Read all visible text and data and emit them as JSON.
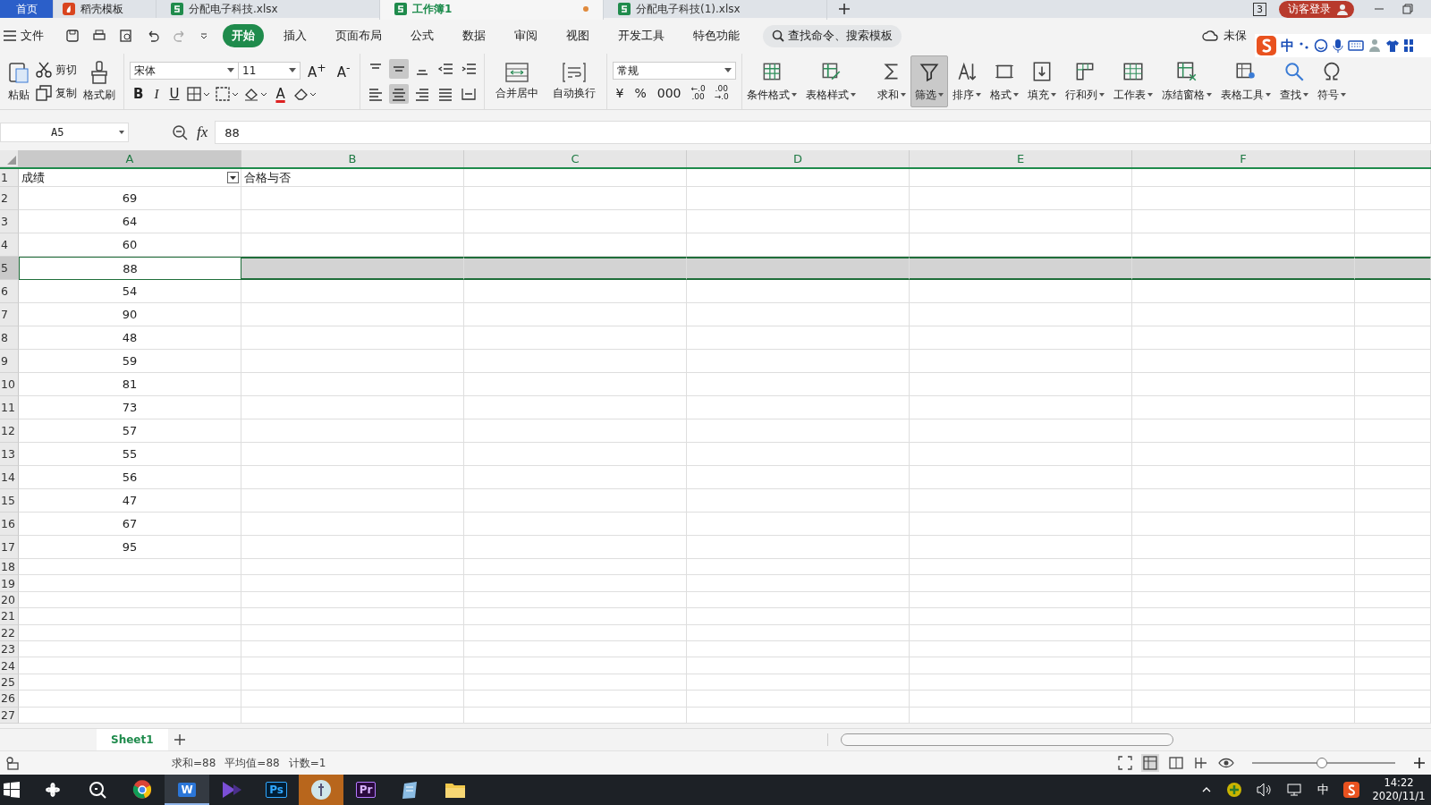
{
  "tabs": [
    {
      "label": "首页",
      "kind": "home",
      "selected": false,
      "unsaved": false
    },
    {
      "label": "稻壳模板",
      "kind": "template",
      "selected": false,
      "unsaved": false
    },
    {
      "label": "分配电子科技.xlsx",
      "kind": "sheet",
      "selected": false,
      "unsaved": false
    },
    {
      "label": "工作簿1",
      "kind": "sheet",
      "selected": true,
      "unsaved": true
    },
    {
      "label": "分配电子科技(1).xlsx",
      "kind": "sheet",
      "selected": false,
      "unsaved": false
    }
  ],
  "window_badge": "3",
  "login_button": "访客登录",
  "menu": {
    "file": "文件",
    "items": [
      {
        "label": "开始",
        "selected": true
      },
      {
        "label": "插入",
        "selected": false
      },
      {
        "label": "页面布局",
        "selected": false
      },
      {
        "label": "公式",
        "selected": false
      },
      {
        "label": "数据",
        "selected": false
      },
      {
        "label": "审阅",
        "selected": false
      },
      {
        "label": "视图",
        "selected": false
      },
      {
        "label": "开发工具",
        "selected": false
      },
      {
        "label": "特色功能",
        "selected": false
      }
    ],
    "search": "查找命令、搜索模板",
    "save_status": "未保"
  },
  "ime": {
    "mode": "中"
  },
  "ribbon": {
    "paste": "粘贴",
    "cut": "剪切",
    "copy": "复制",
    "format_painter": "格式刷",
    "font": "宋体",
    "size": "11",
    "grow": "A$^{+}$",
    "shrink": "A$^{-}$",
    "styles": [
      "B",
      "I",
      "U"
    ],
    "font_color": "A",
    "vertical_align": [
      {
        "selected": false
      },
      {
        "selected": true
      },
      {
        "selected": false
      }
    ],
    "horizontal_align": [
      {
        "selected": false
      },
      {
        "selected": true
      },
      {
        "selected": false
      },
      {
        "selected": false
      }
    ],
    "merge": "合并居中",
    "wrap": "自动换行",
    "number_format": "常规",
    "number_buttons": [
      "¥",
      "%",
      "000"
    ],
    "decimals": [
      {
        "top": "←.0",
        "bottom": ".00"
      },
      {
        "top": ".00",
        "bottom": "→.0"
      }
    ],
    "tools": [
      {
        "label": "条件格式",
        "selected": false
      },
      {
        "label": "表格样式",
        "selected": false
      },
      {
        "label": "求和",
        "selected": false
      },
      {
        "label": "筛选",
        "selected": true
      },
      {
        "label": "排序",
        "selected": false
      },
      {
        "label": "格式",
        "selected": false
      },
      {
        "label": "填充",
        "selected": false
      },
      {
        "label": "行和列",
        "selected": false
      },
      {
        "label": "工作表",
        "selected": false
      },
      {
        "label": "冻结窗格",
        "selected": false
      },
      {
        "label": "表格工具",
        "selected": false
      },
      {
        "label": "查找",
        "selected": false
      },
      {
        "label": "符号",
        "selected": false
      }
    ]
  },
  "formula_bar": {
    "cell": "A5",
    "fx": "fx",
    "value": "88"
  },
  "columns": [
    {
      "label": "A",
      "selected": true
    },
    {
      "label": "B",
      "selected": false
    },
    {
      "label": "C",
      "selected": false
    },
    {
      "label": "D",
      "selected": false
    },
    {
      "label": "E",
      "selected": false
    },
    {
      "label": "F",
      "selected": false
    }
  ],
  "rows": [
    {
      "number": "1",
      "cells": [
        "成绩",
        "合格与否"
      ],
      "filter": true,
      "selected": false
    },
    {
      "number": "2",
      "cells": [
        "69"
      ],
      "selected": false
    },
    {
      "number": "3",
      "cells": [
        "64"
      ],
      "selected": false
    },
    {
      "number": "4",
      "cells": [
        "60"
      ],
      "selected": false
    },
    {
      "number": "5",
      "cells": [
        "88"
      ],
      "selected": true
    },
    {
      "number": "6",
      "cells": [
        "54"
      ],
      "selected": false
    },
    {
      "number": "7",
      "cells": [
        "90"
      ],
      "selected": false
    },
    {
      "number": "8",
      "cells": [
        "48"
      ],
      "selected": false
    },
    {
      "number": "9",
      "cells": [
        "59"
      ],
      "selected": false
    },
    {
      "number": "10",
      "cells": [
        "81"
      ],
      "selected": false
    },
    {
      "number": "11",
      "cells": [
        "73"
      ],
      "selected": false
    },
    {
      "number": "12",
      "cells": [
        "57"
      ],
      "selected": false
    },
    {
      "number": "13",
      "cells": [
        "55"
      ],
      "selected": false
    },
    {
      "number": "14",
      "cells": [
        "56"
      ],
      "selected": false
    },
    {
      "number": "15",
      "cells": [
        "47"
      ],
      "selected": false
    },
    {
      "number": "16",
      "cells": [
        "67"
      ],
      "selected": false
    },
    {
      "number": "17",
      "cells": [
        "95"
      ],
      "selected": false
    },
    {
      "number": "18",
      "selected": false
    },
    {
      "number": "19",
      "selected": false
    },
    {
      "number": "20",
      "selected": false
    },
    {
      "number": "21",
      "selected": false
    },
    {
      "number": "22",
      "selected": false
    },
    {
      "number": "23",
      "selected": false
    },
    {
      "number": "24",
      "selected": false
    },
    {
      "number": "25",
      "selected": false
    },
    {
      "number": "26",
      "selected": false
    },
    {
      "number": "27",
      "selected": false
    }
  ],
  "sheets": [
    {
      "name": "Sheet1",
      "selected": true
    }
  ],
  "status": [
    "求和=88",
    "平均值=88",
    "计数=1"
  ],
  "zoom": {
    "level": 0.48
  },
  "taskbar": {
    "apps": [
      {
        "kind": "pinwheel",
        "selected": false
      },
      {
        "kind": "search",
        "selected": false
      },
      {
        "kind": "browser",
        "selected": false
      },
      {
        "kind": "writer",
        "label": "W",
        "selected": true
      },
      {
        "kind": "player",
        "selected": false
      },
      {
        "kind": "photo",
        "label": "Ps",
        "selected": false
      },
      {
        "kind": "round",
        "selected": false
      },
      {
        "kind": "video",
        "label": "Pr",
        "selected": false
      },
      {
        "kind": "notes",
        "selected": false
      },
      {
        "kind": "folder",
        "selected": false
      }
    ],
    "ime": "中",
    "time": "14:22",
    "date": "2020/11/1"
  }
}
